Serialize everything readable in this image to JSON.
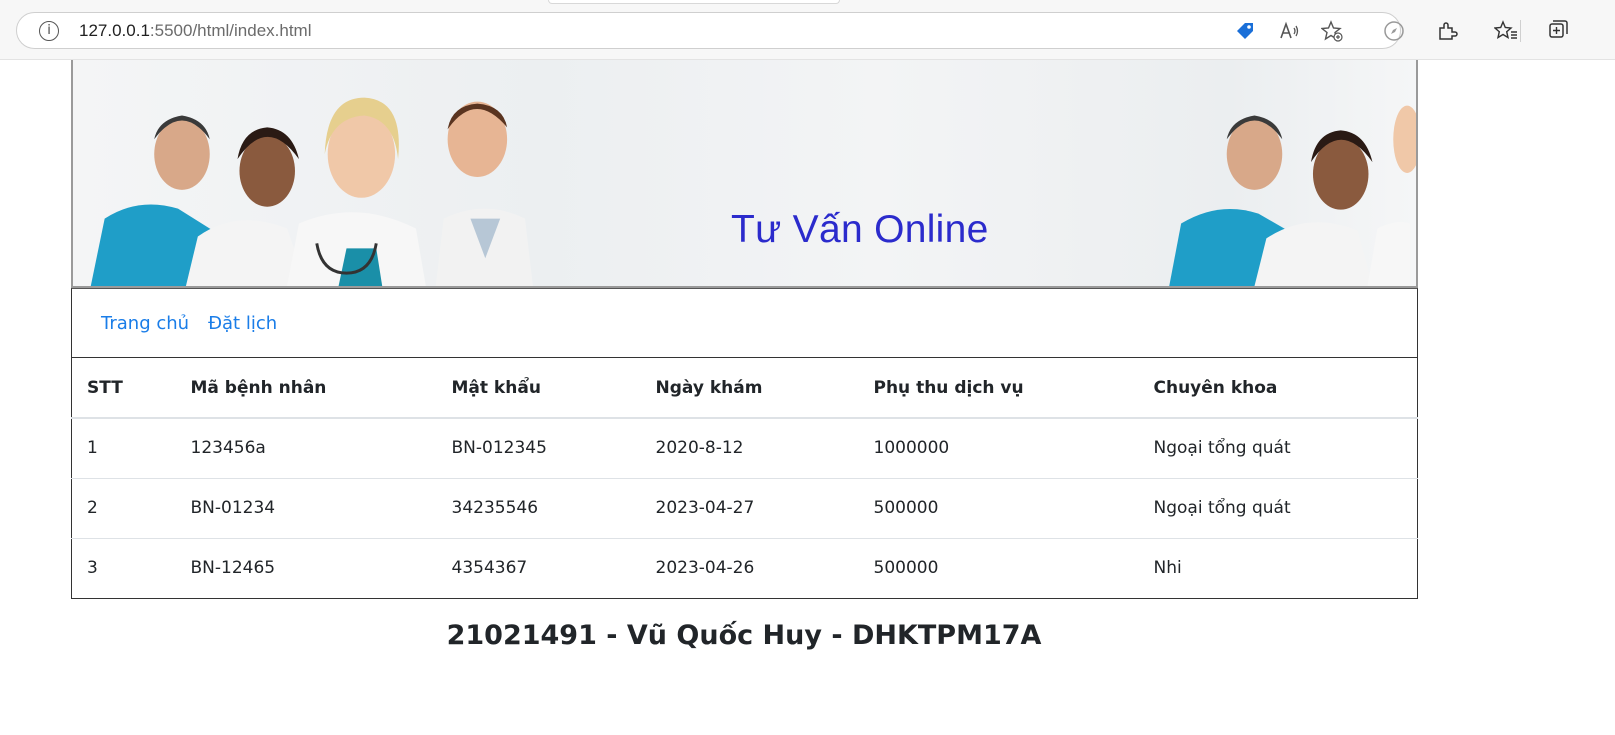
{
  "browser": {
    "url_host": "127.0.0.1",
    "url_rest": ":5500/html/index.html",
    "icons": [
      "info-icon",
      "tag-icon",
      "read-aloud-icon",
      "favorite-add-icon",
      "compass-icon",
      "extensions-icon",
      "favorites-icon",
      "collections-icon"
    ]
  },
  "banner": {
    "title": "Tư Vấn Online"
  },
  "nav": {
    "items": [
      {
        "label": "Trang chủ"
      },
      {
        "label": "Đặt lịch"
      }
    ]
  },
  "table": {
    "headers": [
      "STT",
      "Mã bệnh nhân",
      "Mật khẩu",
      "Ngày khám",
      "Phụ thu dịch vụ",
      "Chuyên khoa"
    ],
    "rows": [
      [
        "1",
        "123456a",
        "BN-012345",
        "2020-8-12",
        "1000000",
        "Ngoại tổng quát"
      ],
      [
        "2",
        "BN-01234",
        "34235546",
        "2023-04-27",
        "500000",
        "Ngoại tổng quát"
      ],
      [
        "3",
        "BN-12465",
        "4354367",
        "2023-04-26",
        "500000",
        "Nhi"
      ]
    ]
  },
  "footer": {
    "text": "21021491 - Vũ Quốc Huy - DHKTPM17A"
  },
  "colors": {
    "link": "#1a7de8",
    "banner_title": "#2b2bcc"
  }
}
